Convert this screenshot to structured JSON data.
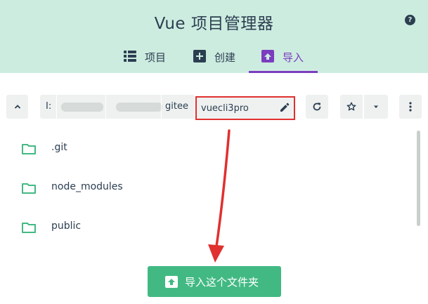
{
  "header": {
    "title": "Vue 项目管理器",
    "help_icon": "help-icon",
    "help_glyph": "?",
    "bg_color": "#cdece0"
  },
  "tabs": [
    {
      "label": "项目",
      "icon": "list-icon",
      "active": false
    },
    {
      "label": "创建",
      "icon": "plus-icon",
      "active": false
    },
    {
      "label": "导入",
      "icon": "import-icon",
      "active": true
    }
  ],
  "accent_color": "#7b3dbf",
  "toolbar": {
    "up_icon": "chevron-up-icon",
    "path": {
      "drive": "I:",
      "segments_blurred": 2,
      "last_segment": "gitee"
    },
    "folder_name": {
      "value": "vuecli3pro",
      "edit_icon": "pencil-icon"
    },
    "refresh_icon": "refresh-icon",
    "favorite_icon": "star-icon",
    "favorites_dropdown_icon": "caret-down-icon",
    "more_icon": "more-vertical-icon"
  },
  "files": [
    {
      "name": ".git",
      "icon": "folder-icon"
    },
    {
      "name": "node_modules",
      "icon": "folder-icon"
    },
    {
      "name": "public",
      "icon": "folder-icon"
    }
  ],
  "import_button": {
    "label": "导入这个文件夹",
    "icon": "import-icon",
    "color": "#42b983"
  },
  "annotation_color": "#e0302f"
}
